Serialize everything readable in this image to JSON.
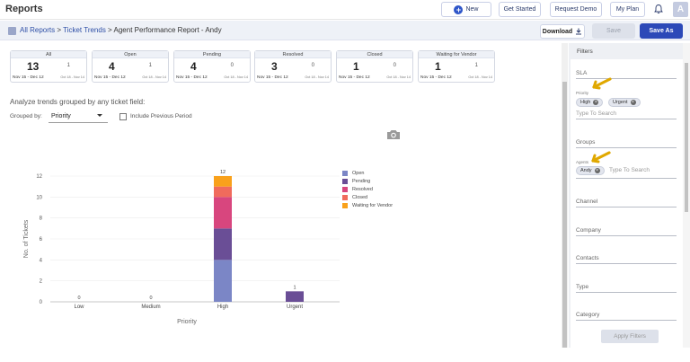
{
  "app": {
    "title": "Reports",
    "avatar_letter": "A"
  },
  "topbar": {
    "new_label": "New",
    "get_started_label": "Get Started",
    "request_demo_label": "Request Demo",
    "my_plan_label": "My Plan"
  },
  "breadcrumb": {
    "all_reports": "All Reports",
    "sep1": " > ",
    "ticket_trends": "Ticket Trends",
    "sep2": " > ",
    "current": "Agent Performance Report - Andy"
  },
  "toolbar": {
    "download_label": "Download",
    "save_label": "Save",
    "save_as_label": "Save As"
  },
  "cards": [
    {
      "label": "All",
      "count": "13",
      "prev": "1",
      "range": "Nov 15 - Dec 12",
      "prev_range": "Oct 18 - Nov 14"
    },
    {
      "label": "Open",
      "count": "4",
      "prev": "1",
      "range": "Nov 15 - Dec 12",
      "prev_range": "Oct 18 - Nov 14"
    },
    {
      "label": "Pending",
      "count": "4",
      "prev": "0",
      "range": "Nov 15 - Dec 12",
      "prev_range": "Oct 18 - Nov 14"
    },
    {
      "label": "Resolved",
      "count": "3",
      "prev": "0",
      "range": "Nov 15 - Dec 12",
      "prev_range": "Oct 18 - Nov 14"
    },
    {
      "label": "Closed",
      "count": "1",
      "prev": "0",
      "range": "Nov 15 - Dec 12",
      "prev_range": "Oct 18 - Nov 14"
    },
    {
      "label": "Waiting for Vendor",
      "count": "1",
      "prev": "1",
      "range": "Nov 15 - Dec 12",
      "prev_range": "Oct 18 - Nov 14"
    }
  ],
  "analyze": {
    "text": "Analyze trends grouped by any ticket field:",
    "group_by_label": "Grouped by:",
    "group_by_value": "Priority",
    "include_prev_label": "Include Previous Period"
  },
  "chart_data": {
    "type": "bar",
    "stacked": true,
    "categories": [
      "Low",
      "Medium",
      "High",
      "Urgent"
    ],
    "totals": [
      0,
      0,
      12,
      1
    ],
    "series": [
      {
        "name": "Open",
        "color": "#7b86c6",
        "values": [
          0,
          0,
          4,
          0
        ]
      },
      {
        "name": "Pending",
        "color": "#6a4e96",
        "values": [
          0,
          0,
          3,
          1
        ]
      },
      {
        "name": "Resolved",
        "color": "#d8467e",
        "values": [
          0,
          0,
          3,
          0
        ]
      },
      {
        "name": "Closed",
        "color": "#f06b5c",
        "values": [
          0,
          0,
          1,
          0
        ]
      },
      {
        "name": "Waiting for Vendor",
        "color": "#f9a11b",
        "values": [
          0,
          0,
          1,
          0
        ]
      }
    ],
    "yticks": [
      0,
      2,
      4,
      6,
      8,
      10,
      12
    ],
    "ylim": [
      0,
      12
    ],
    "xlabel": "Priority",
    "ylabel": "No. of Tickets",
    "legend_position": "right",
    "grid": true
  },
  "filters": {
    "title": "Filters",
    "sla_label": "SLA",
    "priority_label": "Priority",
    "priority_chips": [
      "High",
      "Urgent"
    ],
    "type_to_search": "Type To Search",
    "groups_label": "Groups",
    "agents_label": "Agents",
    "agent_chips": [
      "Andy"
    ],
    "channel_label": "Channel",
    "company_label": "Company",
    "contacts_label": "Contacts",
    "type_label": "Type",
    "category_label": "Category",
    "apply_label": "Apply Filters"
  }
}
